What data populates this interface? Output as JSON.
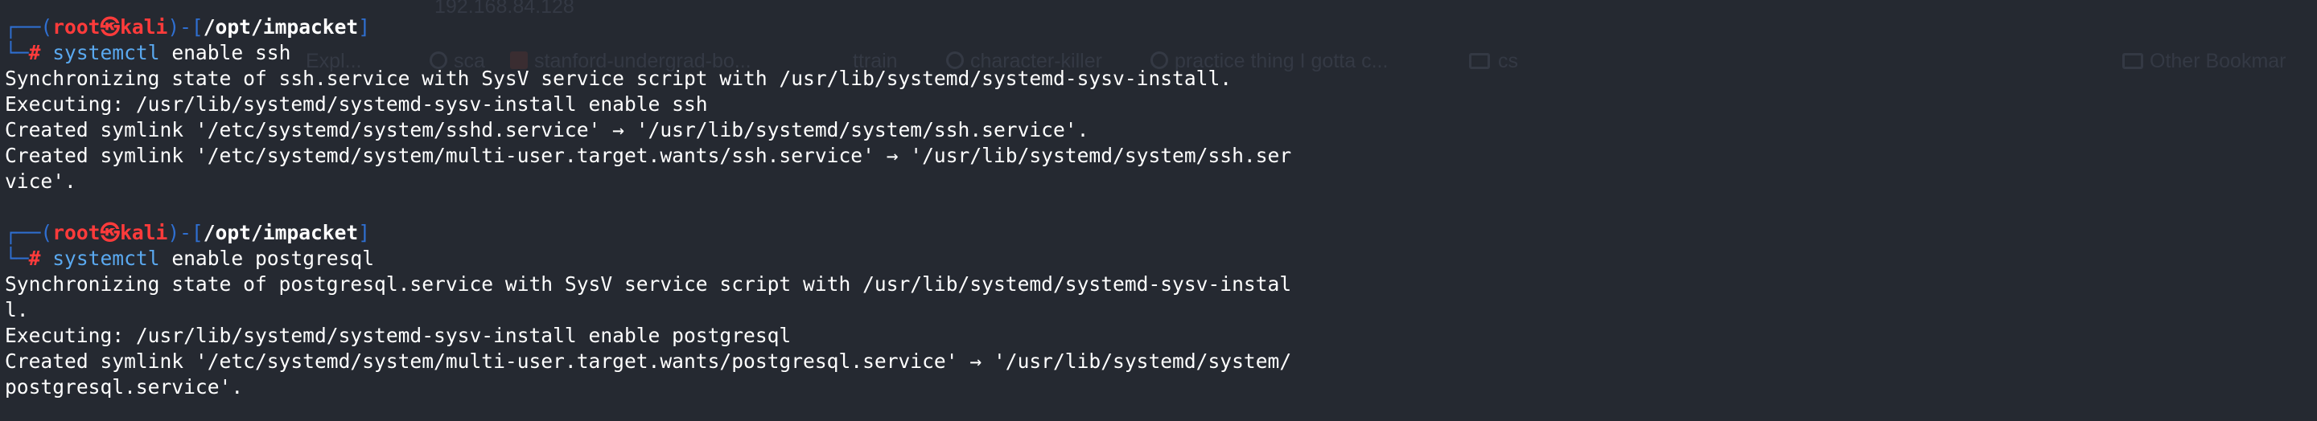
{
  "background_ghost": {
    "address": "192.168.84.128",
    "bookmarks": [
      "Expl...",
      "sca",
      "stanford-undergrad-bo...",
      "ttrain",
      "character-killer",
      "practice thing I gotta c...",
      "cs"
    ],
    "other_bookmarks": "Other Bookmar"
  },
  "terminal": {
    "blocks": [
      {
        "prompt": {
          "frame_top_left": "┌──(",
          "user": "root",
          "at": "㉿",
          "host": "kali",
          "frame_mid": ")-[",
          "path": "/opt/impacket",
          "frame_end": "]",
          "frame_bottom": "└─",
          "hash": "#"
        },
        "command": "systemctl",
        "args": " enable ssh",
        "output": [
          "Synchronizing state of ssh.service with SysV service script with /usr/lib/systemd/systemd-sysv-install.",
          "Executing: /usr/lib/systemd/systemd-sysv-install enable ssh",
          "Created symlink '/etc/systemd/system/sshd.service' → '/usr/lib/systemd/system/ssh.service'.",
          "Created symlink '/etc/systemd/system/multi-user.target.wants/ssh.service' → '/usr/lib/systemd/system/ssh.ser",
          "vice'."
        ]
      },
      {
        "prompt": {
          "frame_top_left": "┌──(",
          "user": "root",
          "at": "㉿",
          "host": "kali",
          "frame_mid": ")-[",
          "path": "/opt/impacket",
          "frame_end": "]",
          "frame_bottom": "└─",
          "hash": "#"
        },
        "command": "systemctl",
        "args": " enable postgresql",
        "output": [
          "Synchronizing state of postgresql.service with SysV service script with /usr/lib/systemd/systemd-sysv-instal",
          "l.",
          "Executing: /usr/lib/systemd/systemd-sysv-install enable postgresql",
          "Created symlink '/etc/systemd/system/multi-user.target.wants/postgresql.service' → '/usr/lib/systemd/system/",
          "postgresql.service'."
        ]
      }
    ]
  },
  "colors": {
    "background": "#252931",
    "prompt_frame": "#2f6fd1",
    "prompt_user_host": "#ff3b3b",
    "command": "#5aa9f0",
    "text": "#ffffff"
  }
}
